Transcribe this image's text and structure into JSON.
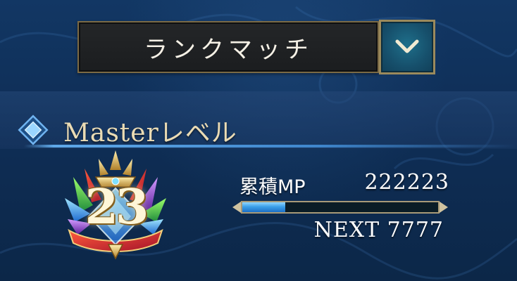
{
  "mode_select": {
    "label": "ランクマッチ",
    "dropdown_icon": "chevron-down-icon"
  },
  "section": {
    "title": "Masterレベル",
    "icon": "diamond-icon"
  },
  "master": {
    "level": "23",
    "mp_label": "累積MP",
    "mp_value": "222223",
    "next_label": "NEXT 7777",
    "progress_fraction": 0.22
  },
  "colors": {
    "background": "#0f2f58",
    "accent_gold": "#9b8a5c",
    "title_text": "#eadbb4",
    "bar_fill": "#3b9fe8"
  }
}
